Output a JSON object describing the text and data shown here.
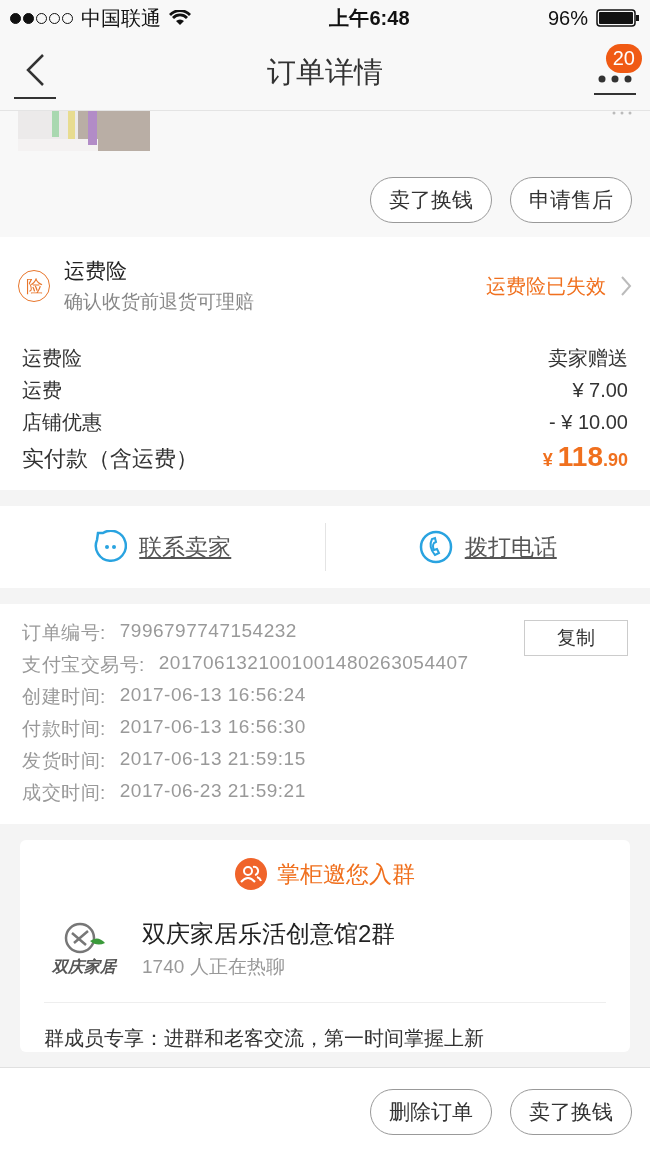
{
  "status_bar": {
    "carrier": "中国联通",
    "time": "上午6:48",
    "battery": "96%"
  },
  "nav": {
    "title": "订单详情",
    "badge": "20"
  },
  "product_actions": [
    "卖了换钱",
    "申请售后"
  ],
  "insurance": {
    "icon": "险",
    "title": "运费险",
    "subtitle": "确认收货前退货可理赔",
    "status": "运费险已失效"
  },
  "fees": [
    {
      "label": "运费险",
      "value": "卖家赠送",
      "kind": "plain"
    },
    {
      "label": "运费",
      "value": "¥ 7.00",
      "kind": "plain"
    },
    {
      "label": "店铺优惠",
      "value": "- ¥ 10.00",
      "kind": "plain"
    },
    {
      "label": "实付款（含运费）",
      "currency": "¥",
      "integer": "118",
      "decimal": ".90",
      "kind": "total"
    }
  ],
  "contact": [
    {
      "label": "联系卖家",
      "kind": "chat"
    },
    {
      "label": "拨打电话",
      "kind": "phone"
    }
  ],
  "order_info": [
    {
      "label": "订单编号:",
      "value": "7996797747154232"
    },
    {
      "label": "支付宝交易号:",
      "value": "2017061321001001480263054407"
    },
    {
      "label": "创建时间:",
      "value": "2017-06-13 16:56:24"
    },
    {
      "label": "付款时间:",
      "value": "2017-06-13 16:56:30"
    },
    {
      "label": "发货时间:",
      "value": "2017-06-13 21:59:15"
    },
    {
      "label": "成交时间:",
      "value": "2017-06-23 21:59:21"
    }
  ],
  "copy_button": "复制",
  "group_card": {
    "heading": "掌柜邀您入群",
    "logo_text": "双庆家居",
    "name": "双庆家居乐活创意馆2群",
    "members": "1740 人正在热聊",
    "description": "群成员专享：进群和老客交流，第一时间掌握上新"
  },
  "bottom_actions": [
    "删除订单",
    "卖了换钱"
  ]
}
